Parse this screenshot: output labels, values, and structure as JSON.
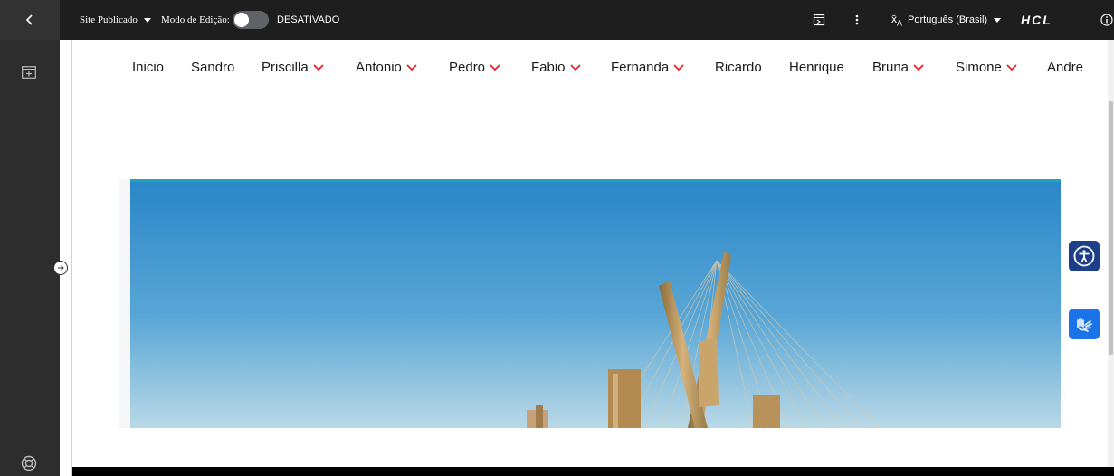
{
  "topbar": {
    "back_icon": "chevron-left-icon",
    "site_status": "Site Publicado",
    "edit_mode_label": "Modo de Edição:",
    "edit_mode_toggle_on": false,
    "edit_mode_state": "DESATIVADO",
    "preview_icon": "preview-icon",
    "more_icon": "more-vertical-icon",
    "language": "Português (Brasil)",
    "language_icon": "translate-icon",
    "brand": "HCL",
    "info_icon": "info-icon"
  },
  "leftrail": {
    "add_icon": "add-panel-icon",
    "help_icon": "lifebuoy-icon",
    "collapse_icon": "arrow-right-circle-icon"
  },
  "nav": {
    "items": [
      {
        "label": "Inicio",
        "dropdown": false
      },
      {
        "label": "Sandro",
        "dropdown": false
      },
      {
        "label": "Priscilla",
        "dropdown": true
      },
      {
        "label": "Antonio",
        "dropdown": true
      },
      {
        "label": "Pedro",
        "dropdown": true
      },
      {
        "label": "Fabio",
        "dropdown": true
      },
      {
        "label": "Fernanda",
        "dropdown": true
      },
      {
        "label": "Ricardo",
        "dropdown": false
      },
      {
        "label": "Henrique",
        "dropdown": false
      },
      {
        "label": "Bruna",
        "dropdown": true
      },
      {
        "label": "Simone",
        "dropdown": true
      },
      {
        "label": "Andre",
        "dropdown": false
      }
    ],
    "chevron_color": "#e8202a"
  },
  "hero": {
    "image_subject": "cable-stayed bridge under blue sky"
  },
  "floating": {
    "accessibility_icon": "accessibility-icon",
    "accessibility_color": "#1d3f8a",
    "sign_language_icon": "sign-language-hands-icon",
    "sign_language_color": "#1a73e8"
  }
}
